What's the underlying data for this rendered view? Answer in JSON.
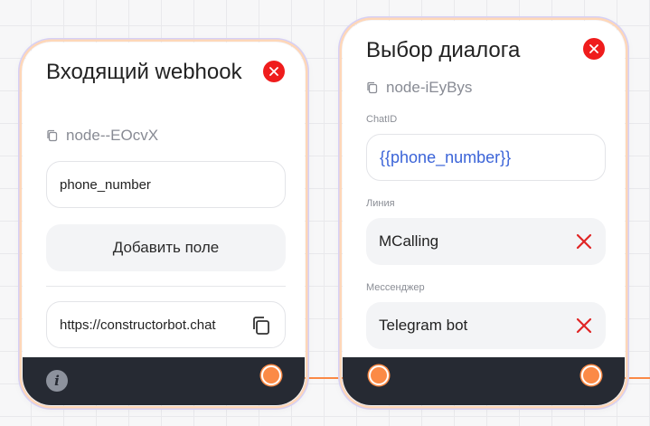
{
  "nodes": {
    "incoming": {
      "title": "Входящий webhook",
      "node_id": "node--EOcvX",
      "field_value": "phone_number",
      "add_field_label": "Добавить поле",
      "webhook_url": "https://constructorbot.chat"
    },
    "dialog": {
      "title": "Выбор диалога",
      "node_id": "node-iEyBys",
      "chat_label": "ChatID",
      "chat_value": "{{phone_number}}",
      "line_label": "Линия",
      "line_value": "MCalling",
      "messenger_label": "Мессенджер",
      "messenger_value": "Telegram bot"
    }
  },
  "info_glyph": "i",
  "colors": {
    "accent": "#fb8a46",
    "close": "#ef1c1c",
    "footer": "#262a33",
    "variable": "#3b64d8",
    "clear_x": "#e02424"
  },
  "icons": [
    "close-icon",
    "copy-icon",
    "info-icon",
    "clear-icon",
    "port-icon"
  ]
}
